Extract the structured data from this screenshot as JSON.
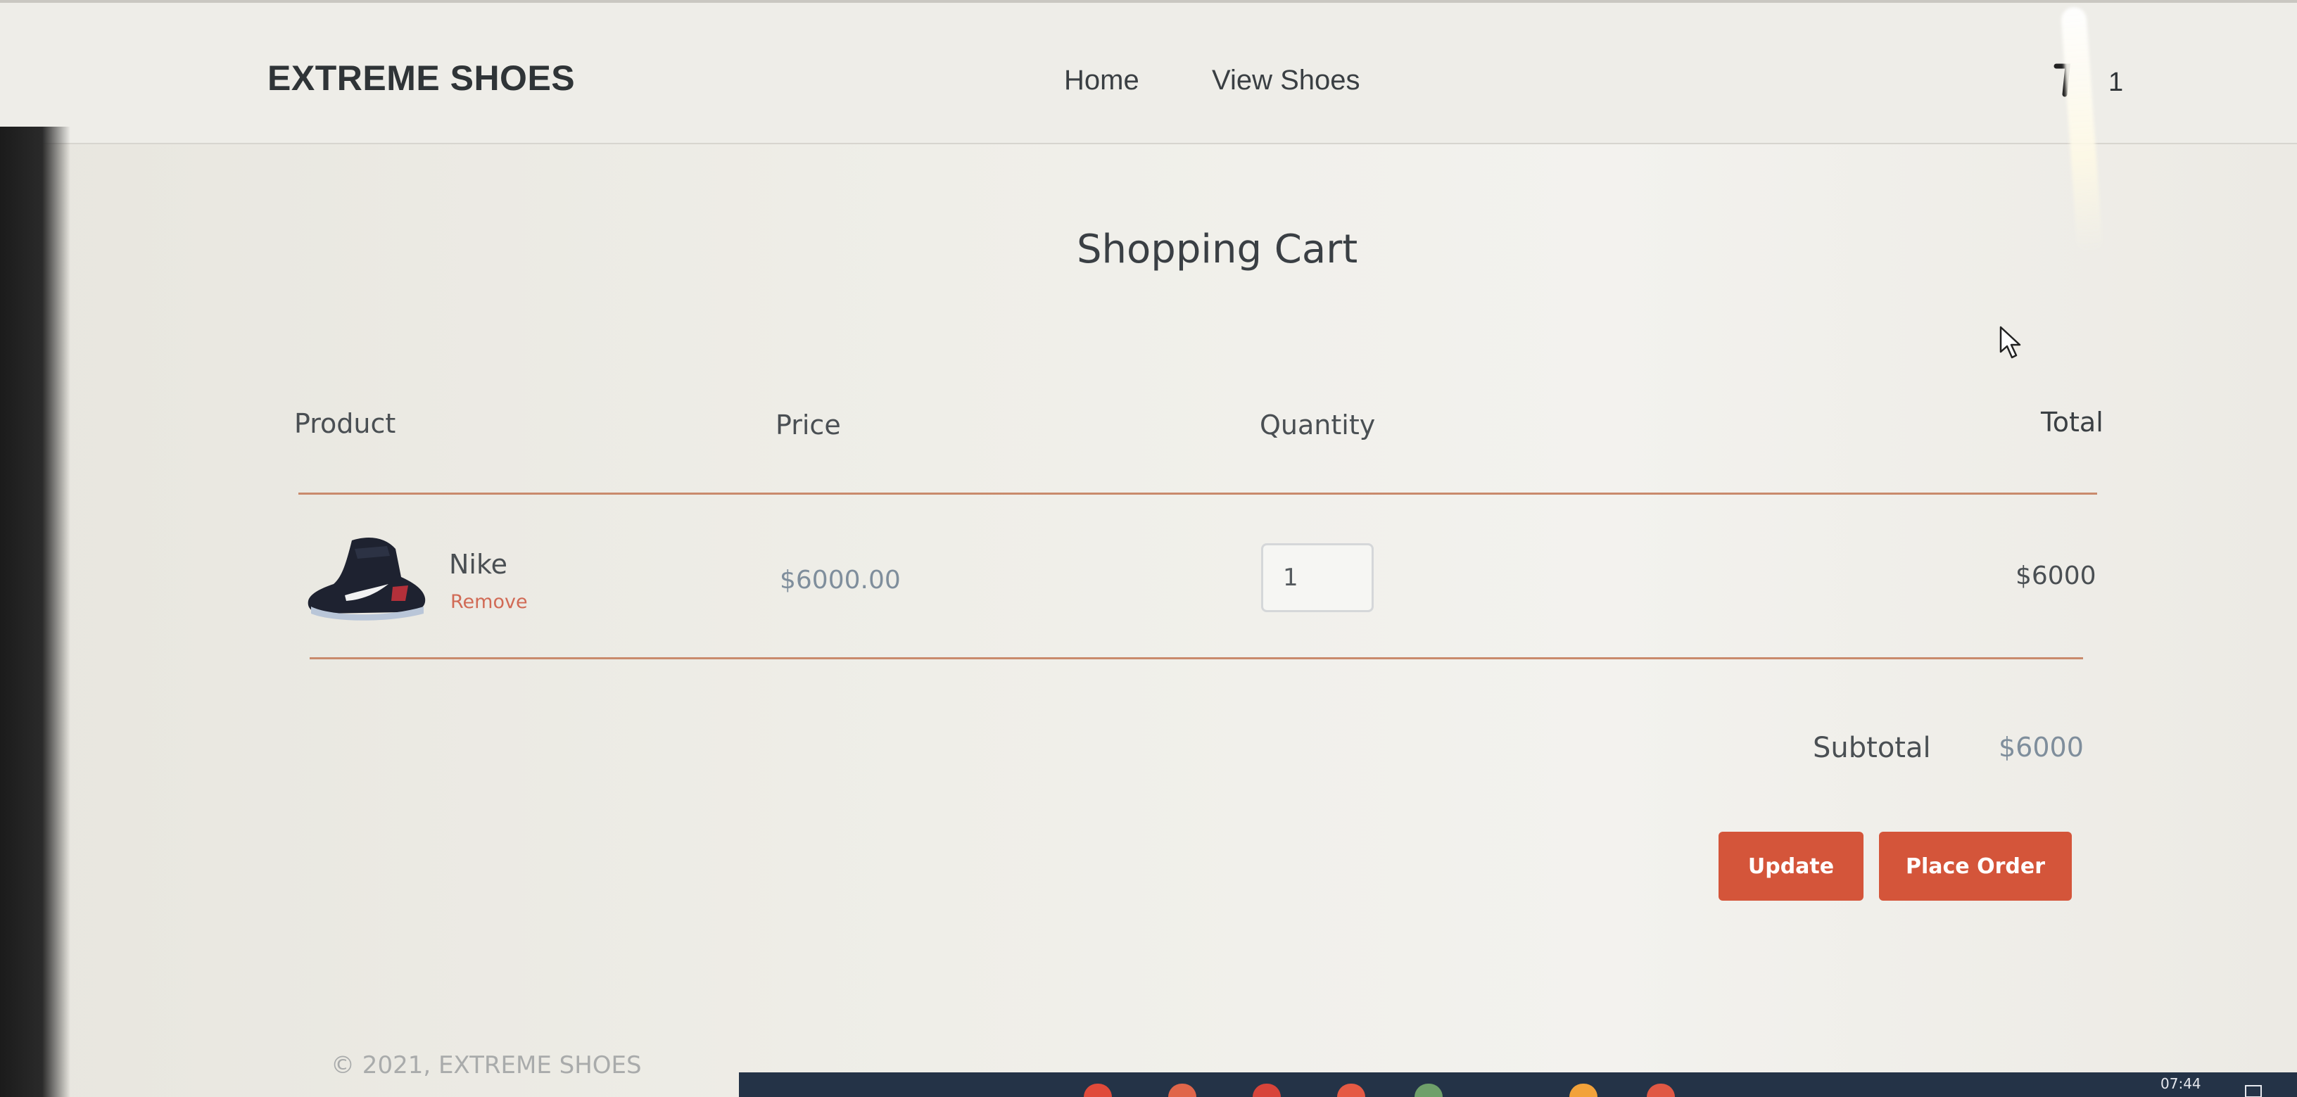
{
  "navbar": {
    "brand": "EXTREME SHOES",
    "links": [
      "Home",
      "View Shoes"
    ],
    "cart_icon": "cart-icon",
    "cart_count": "1"
  },
  "page": {
    "title": "Shopping Cart"
  },
  "cart": {
    "columns": [
      "Product",
      "Price",
      "Quantity",
      "Total"
    ],
    "items": [
      {
        "image_icon": "sneaker-image",
        "name": "Nike",
        "remove_label": "Remove",
        "price": "$6000.00",
        "quantity": "1",
        "total": "$6000"
      }
    ],
    "subtotal_label": "Subtotal",
    "subtotal_value": "$6000",
    "update_label": "Update",
    "place_order_label": "Place Order"
  },
  "footer": {
    "text": "© 2021, EXTREME SHOES"
  },
  "taskbar": {
    "clock": "07:44"
  },
  "colors": {
    "accent": "#d4553a",
    "rule": "#c98a6c",
    "remove_link": "#d16a55",
    "muted_value": "#7f8e9c"
  }
}
